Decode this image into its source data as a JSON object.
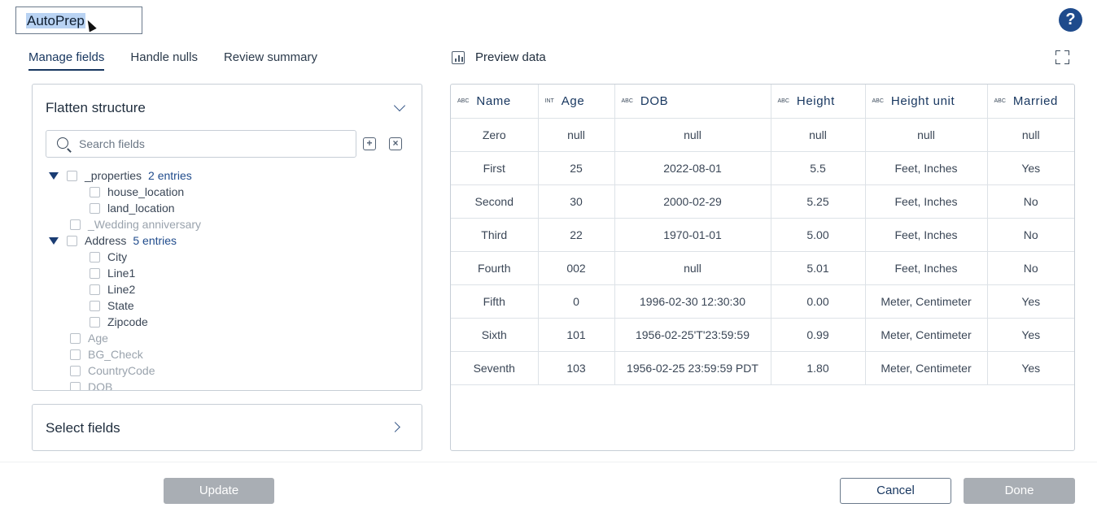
{
  "header": {
    "title": "AutoPrep",
    "help_icon": "?"
  },
  "tabs": [
    {
      "label": "Manage fields",
      "active": true
    },
    {
      "label": "Handle nulls",
      "active": false
    },
    {
      "label": "Review summary",
      "active": false
    }
  ],
  "flatten": {
    "title": "Flatten structure",
    "search_placeholder": "Search fields",
    "tree": [
      {
        "label": "_properties",
        "entries": "2 entries",
        "expanded": true,
        "level": 0,
        "dim": false
      },
      {
        "label": "house_location",
        "level": 1,
        "dim": false
      },
      {
        "label": "land_location",
        "level": 1,
        "dim": false
      },
      {
        "label": "_Wedding anniversary",
        "level": 0,
        "dim": true
      },
      {
        "label": "Address",
        "entries": "5 entries",
        "expanded": true,
        "level": 0,
        "dim": false
      },
      {
        "label": "City",
        "level": 1,
        "dim": false
      },
      {
        "label": "Line1",
        "level": 1,
        "dim": false
      },
      {
        "label": "Line2",
        "level": 1,
        "dim": false
      },
      {
        "label": "State",
        "level": 1,
        "dim": false
      },
      {
        "label": "Zipcode",
        "level": 1,
        "dim": false
      },
      {
        "label": "Age",
        "level": 0,
        "dim": true
      },
      {
        "label": "BG_Check",
        "level": 0,
        "dim": true
      },
      {
        "label": "CountryCode",
        "level": 0,
        "dim": true
      },
      {
        "label": "DOB",
        "level": 0,
        "dim": true
      }
    ]
  },
  "select_fields": {
    "title": "Select fields"
  },
  "preview": {
    "title": "Preview data",
    "columns": [
      {
        "type": "ABC",
        "name": "Name"
      },
      {
        "type": "INT",
        "name": "Age"
      },
      {
        "type": "ABC",
        "name": "DOB"
      },
      {
        "type": "ABC",
        "name": "Height"
      },
      {
        "type": "ABC",
        "name": "Height unit"
      },
      {
        "type": "ABC",
        "name": "Married"
      }
    ],
    "rows": [
      [
        "Zero",
        "null",
        "null",
        "null",
        "null",
        "null"
      ],
      [
        "First",
        "25",
        "2022-08-01",
        "5.5",
        "Feet, Inches",
        "Yes"
      ],
      [
        "Second",
        "30",
        "2000-02-29",
        "5.25",
        "Feet, Inches",
        "No"
      ],
      [
        "Third",
        "22",
        "1970-01-01",
        "5.00",
        "Feet, Inches",
        "No"
      ],
      [
        "Fourth",
        "002",
        "null",
        "5.01",
        "Feet, Inches",
        "No"
      ],
      [
        "Fifth",
        "0",
        "1996-02-30 12:30:30",
        "0.00",
        "Meter, Centimeter",
        "Yes"
      ],
      [
        "Sixth",
        "101",
        "1956-02-25'T'23:59:59",
        "0.99",
        "Meter, Centimeter",
        "Yes"
      ],
      [
        "Seventh",
        "103",
        "1956-02-25 23:59:59 PDT",
        "1.80",
        "Meter, Centimeter",
        "Yes"
      ]
    ]
  },
  "footer": {
    "update_label": "Update",
    "cancel_label": "Cancel",
    "done_label": "Done"
  },
  "colors": {
    "accent": "#17365f",
    "help": "#1f4b8c",
    "disabled_button": "#a9aeb4",
    "selection": "#b9d3f3"
  }
}
